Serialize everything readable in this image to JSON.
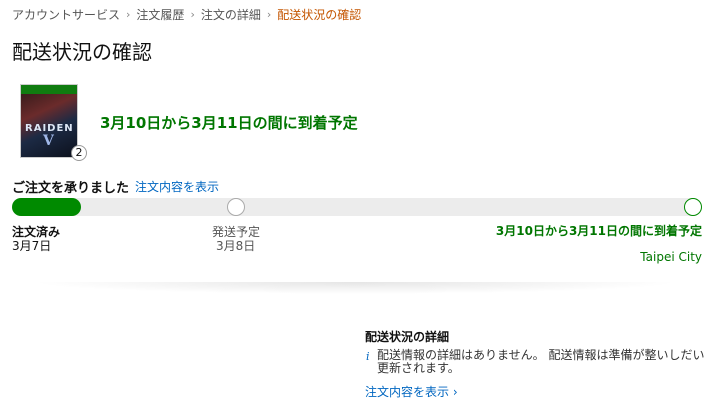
{
  "breadcrumb": {
    "items": [
      "アカウントサービス",
      "注文履歴",
      "注文の詳細"
    ],
    "current": "配送状況の確認",
    "separator": "›"
  },
  "page_title": "配送状況の確認",
  "product": {
    "cover_text": "RAIDEN V",
    "quantity": "2"
  },
  "delivery_estimate": "3月10日から3月11日の間に到着予定",
  "status": {
    "headline": "ご注文を承りました",
    "view_order_link": "注文内容を表示"
  },
  "progress": {
    "fraction_complete": 0.1,
    "steps": [
      {
        "label": "注文済み",
        "date": "3月7日",
        "state": "done"
      },
      {
        "label": "発送予定",
        "date": "3月8日",
        "state": "pending"
      },
      {
        "label": "3月10日から3月11日の間に到着予定",
        "date": "",
        "state": "target"
      }
    ],
    "city": "Taipei City"
  },
  "tracking_details": {
    "title": "配送状況の詳細",
    "info_icon": "i",
    "message": "配送情報の詳細はありません。 配送情報は準備が整いしだい更新されます。",
    "view_order_link": "注文内容を表示 ›"
  },
  "colors": {
    "accent_green": "#008a00",
    "link_blue": "#0066c0",
    "breadcrumb_current": "#c45500"
  }
}
